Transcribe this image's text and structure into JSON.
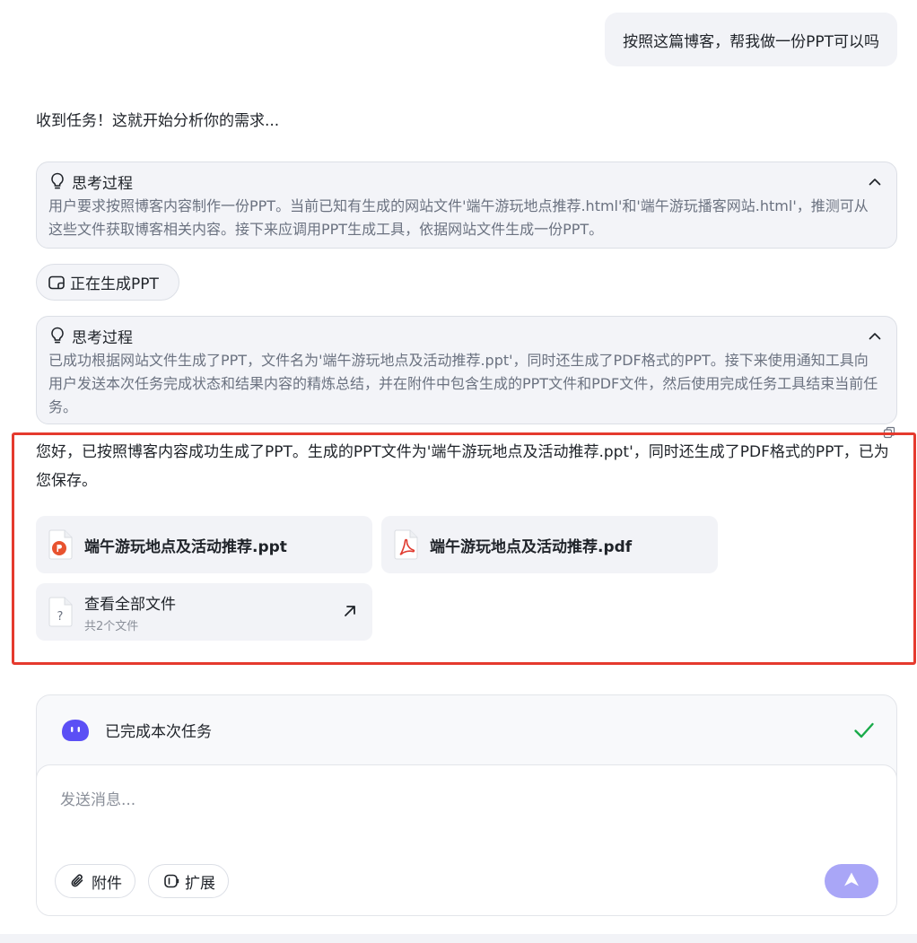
{
  "user_message": "按照这篇博客，帮我做一份PPT可以吗",
  "assistant_intro": "收到任务！这就开始分析你的需求...",
  "thinking_blocks": [
    {
      "title": "思考过程",
      "text": "用户要求按照博客内容制作一份PPT。当前已知有生成的网站文件'端午游玩地点推荐.html'和'端午游玩播客网站.html'，推测可从这些文件获取博客相关内容。接下来应调用PPT生成工具，依据网站文件生成一份PPT。"
    },
    {
      "title": "思考过程",
      "text": "已成功根据网站文件生成了PPT，文件名为'端午游玩地点及活动推荐.ppt'，同时还生成了PDF格式的PPT。接下来使用通知工具向用户发送本次任务完成状态和结果内容的精炼总结，并在附件中包含生成的PPT文件和PDF文件，然后使用完成任务工具结束当前任务。"
    }
  ],
  "generating_label": "正在生成PPT",
  "reply_text": "您好，已按照博客内容成功生成了PPT。生成的PPT文件为'端午游玩地点及活动推荐.ppt'，同时还生成了PDF格式的PPT，已为您保存。",
  "files": [
    {
      "name": "端午游玩地点及活动推荐.ppt",
      "icon": "ppt-file-icon"
    },
    {
      "name": "端午游玩地点及活动推荐.pdf",
      "icon": "pdf-file-icon"
    }
  ],
  "all_files": {
    "title": "查看全部文件",
    "subtitle": "共2个文件"
  },
  "composer": {
    "status_text": "已完成本次任务",
    "placeholder": "发送消息...",
    "attach_label": "附件",
    "extend_label": "扩展"
  },
  "colors": {
    "accent": "#5b4ff5",
    "send_button": "#a9a6f7",
    "success": "#1aab4a",
    "highlight_border": "#e53a2e",
    "ppt": "#e8532f",
    "pdf": "#e03a2f"
  }
}
